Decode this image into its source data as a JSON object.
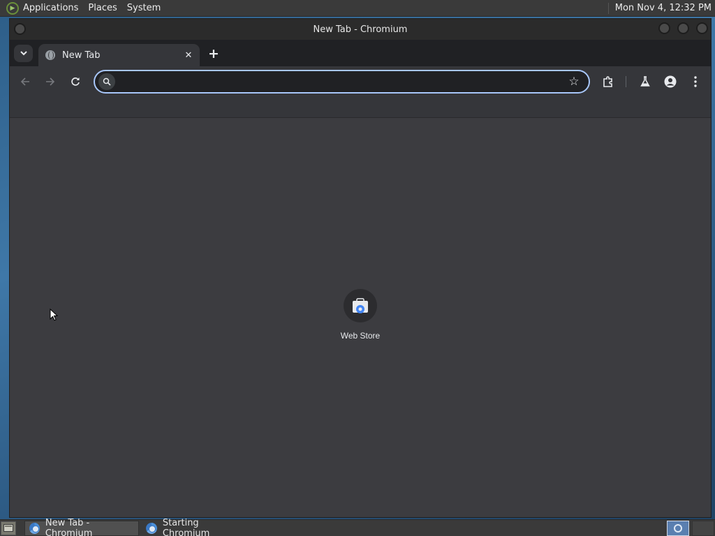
{
  "top_panel": {
    "menus": [
      "Applications",
      "Places",
      "System"
    ],
    "clock": "Mon Nov  4, 12:32 PM"
  },
  "window": {
    "title": "New Tab - Chromium"
  },
  "browser": {
    "tabs": [
      {
        "title": "New Tab",
        "active": true
      }
    ],
    "omnibox": {
      "value": "",
      "placeholder": ""
    },
    "shortcuts": [
      {
        "label": "Web Store"
      }
    ]
  },
  "taskbar": {
    "tasks": [
      {
        "label": "New Tab - Chromium",
        "active": true
      },
      {
        "label": "Starting Chromium",
        "active": false
      }
    ]
  },
  "colors": {
    "accent": "#a8c7fa",
    "panel": "#3a3a3a",
    "ntp_background": "#3c3c40"
  }
}
